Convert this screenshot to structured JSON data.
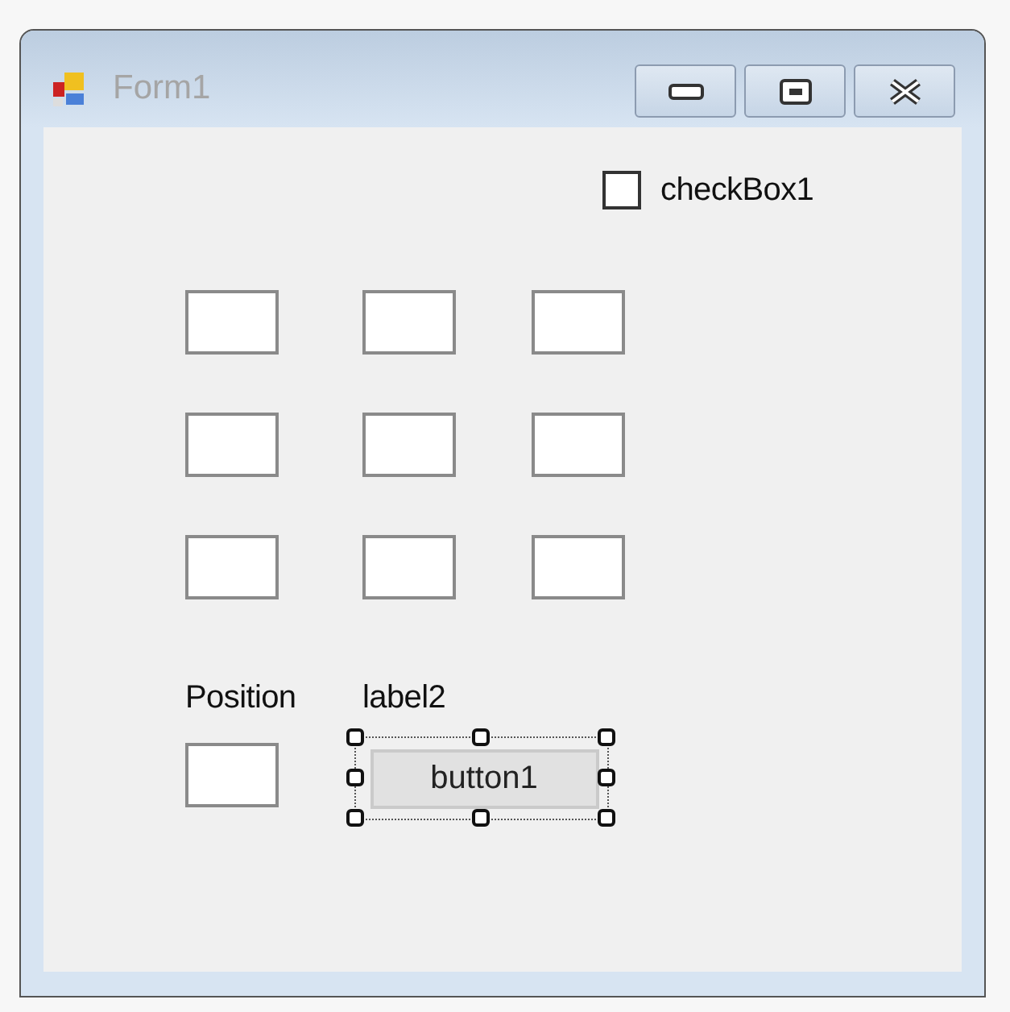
{
  "window": {
    "title": "Form1"
  },
  "checkbox": {
    "label": "checkBox1",
    "checked": false
  },
  "text_boxes": [
    {
      "kind": "textbox"
    },
    {
      "kind": "textbox"
    },
    {
      "kind": "textbox"
    },
    {
      "kind": "textbox"
    },
    {
      "kind": "textbox"
    },
    {
      "kind": "textbox"
    },
    {
      "kind": "textbox"
    },
    {
      "kind": "textbox"
    },
    {
      "kind": "textbox"
    }
  ],
  "labels": [
    "Position",
    "label2"
  ],
  "bottom_text_box": {
    "kind": "textbox"
  },
  "button": {
    "label": "button1",
    "selected": true
  }
}
